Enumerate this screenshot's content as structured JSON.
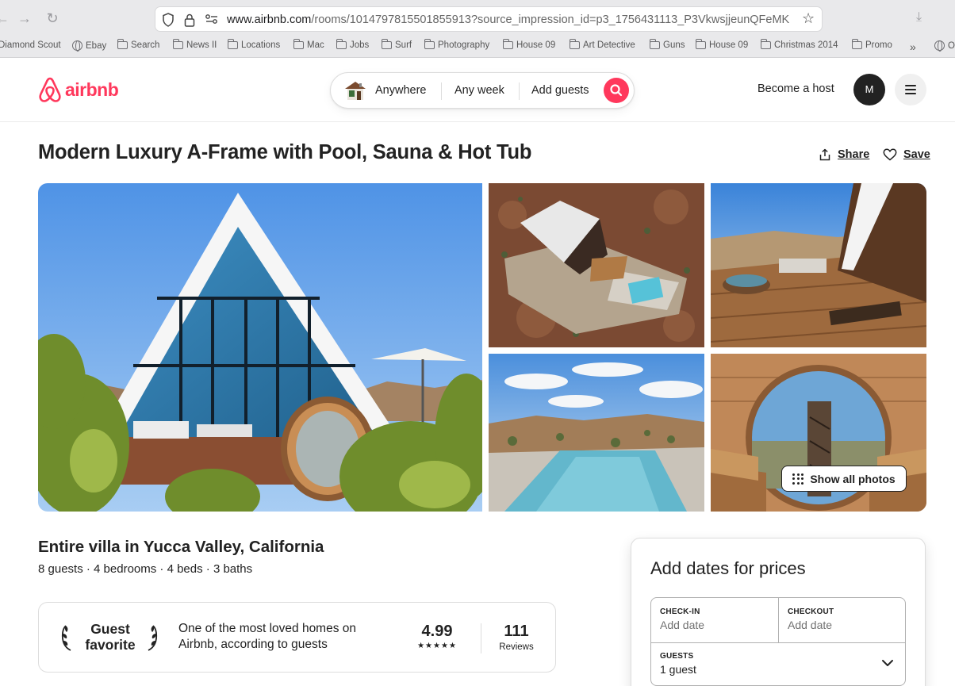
{
  "browser": {
    "url_domain": "www.airbnb.com",
    "url_path": "/rooms/1014797815501855913?source_impression_id=p3_1756431113_P3VkwsjjeunQFeMK",
    "bookmarks": [
      "Diamond Scout",
      "Ebay",
      "Search",
      "News II",
      "Locations",
      "Mac",
      "Jobs",
      "Surf",
      "Photography",
      "House 09",
      "Art Detective",
      "Guns",
      "House 09",
      "Christmas 2014",
      "Promo",
      "Ot"
    ]
  },
  "header": {
    "logo_text": "airbnb",
    "search": {
      "location": "Anywhere",
      "dates": "Any week",
      "guests": "Add guests"
    },
    "become_host": "Become a host",
    "avatar_initial": "M"
  },
  "listing": {
    "title": "Modern Luxury A-Frame with Pool, Sauna & Hot Tub",
    "share_label": "Share",
    "save_label": "Save",
    "show_all_photos": "Show all photos",
    "subtitle": "Entire villa in Yucca Valley, California",
    "facts": "8 guests · 4 bedrooms · 4 beds · 3 baths",
    "guest_favorite": {
      "badge_line1": "Guest",
      "badge_line2": "favorite",
      "description": "One of the most loved homes on Airbnb, according to guests",
      "rating": "4.99",
      "stars": "★★★★★",
      "reviews_count": "111",
      "reviews_label": "Reviews"
    }
  },
  "booking": {
    "title": "Add dates for prices",
    "checkin_label": "CHECK-IN",
    "checkin_value": "Add date",
    "checkout_label": "CHECKOUT",
    "checkout_value": "Add date",
    "guests_label": "GUESTS",
    "guests_value": "1 guest"
  },
  "colors": {
    "brand": "#ff385c",
    "text": "#222222",
    "muted": "#717171",
    "border": "#dddddd"
  }
}
